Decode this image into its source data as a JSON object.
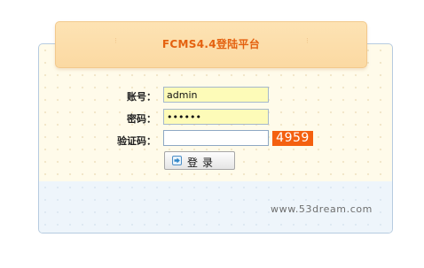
{
  "header": {
    "title": "FCMS4.4登陆平台",
    "deco_left": "⁝",
    "deco_right": "⁝"
  },
  "form": {
    "account_label": "账号：",
    "account_value": "admin",
    "password_label": "密码：",
    "password_value": "••••••",
    "captcha_label": "验证码：",
    "captcha_value": "",
    "captcha_image_text": "4959",
    "login_button_label": "登录",
    "login_button_icon": "arrow-right-icon"
  },
  "footer": {
    "site_link": "www.53dream.com"
  },
  "colors": {
    "accent_orange": "#e4610f",
    "captcha_bg": "#f46010",
    "field_fill": "#fdfbb8",
    "panel_bg": "#fffbea",
    "panel_bottom_bg": "#eef5fb"
  }
}
